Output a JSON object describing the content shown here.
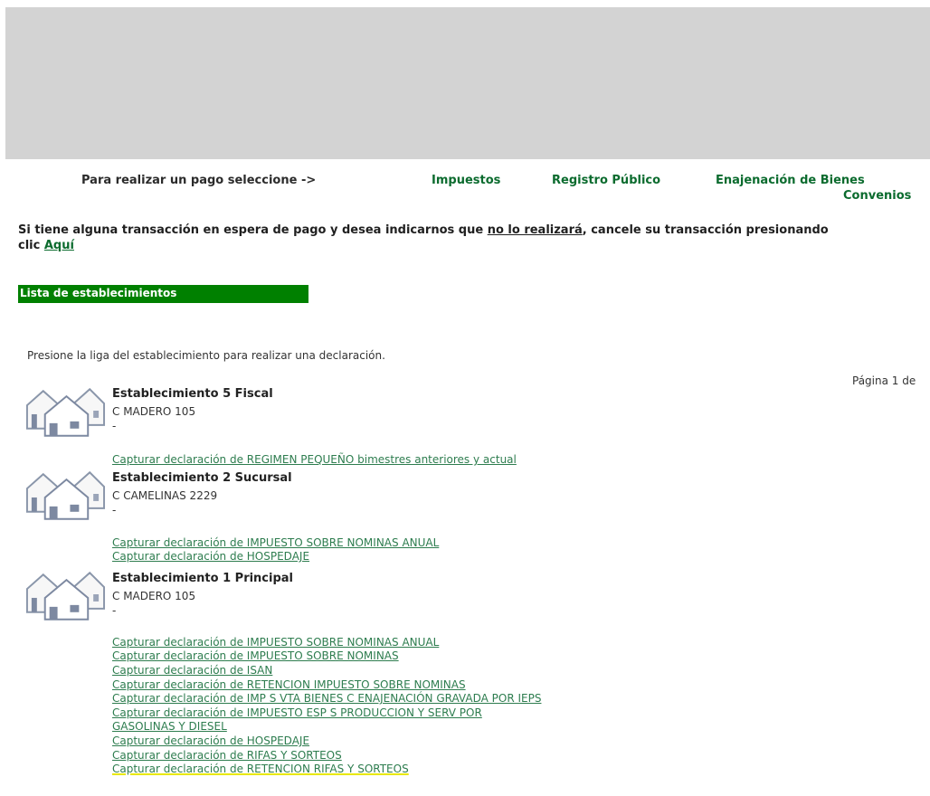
{
  "paybar": {
    "label": "Para realizar un pago seleccione ->",
    "links": [
      "Impuestos",
      "Registro Público",
      "Enajenación de Bienes",
      "Convenios"
    ]
  },
  "notice": {
    "text_before": "Si tiene alguna transacción en espera de pago y desea indicarnos que ",
    "underlined": "no lo realizará",
    "text_after": ", cancele su transacción presionando clic ",
    "link": "Aquí"
  },
  "section": {
    "title": "Lista de establecimientos"
  },
  "instructions": "Presione la liga del establecimiento para realizar una declaración.",
  "pager": "Página 1 de",
  "establishments": [
    {
      "name": "Establecimiento 5 Fiscal",
      "address": "C MADERO 105",
      "extra": "-",
      "declarations": [
        "Capturar declaración de REGIMEN PEQUEÑO bimestres anteriores y actual"
      ]
    },
    {
      "name": "Establecimiento 2 Sucursal",
      "address": "C CAMELINAS 2229",
      "extra": "-",
      "declarations": [
        "Capturar declaración de IMPUESTO SOBRE NOMINAS ANUAL",
        "Capturar declaración de HOSPEDAJE"
      ]
    },
    {
      "name": "Establecimiento 1 Principal",
      "address": "C MADERO 105",
      "extra": "-",
      "declarations": [
        "Capturar declaración de IMPUESTO SOBRE NOMINAS ANUAL",
        "Capturar declaración de IMPUESTO SOBRE NOMINAS",
        "Capturar declaración de ISAN",
        "Capturar declaración de RETENCION IMPUESTO SOBRE NOMINAS",
        "Capturar declaración de IMP S VTA BIENES C ENAJENACIÓN GRAVADA POR IEPS",
        "Capturar declaración de IMPUESTO ESP S PRODUCCION Y SERV POR",
        "GASOLINAS Y DIESEL",
        "Capturar declaración de HOSPEDAJE",
        "Capturar declaración de RIFAS Y SORTEOS",
        "Capturar declaración de RETENCION RIFAS Y SORTEOS"
      ]
    }
  ]
}
